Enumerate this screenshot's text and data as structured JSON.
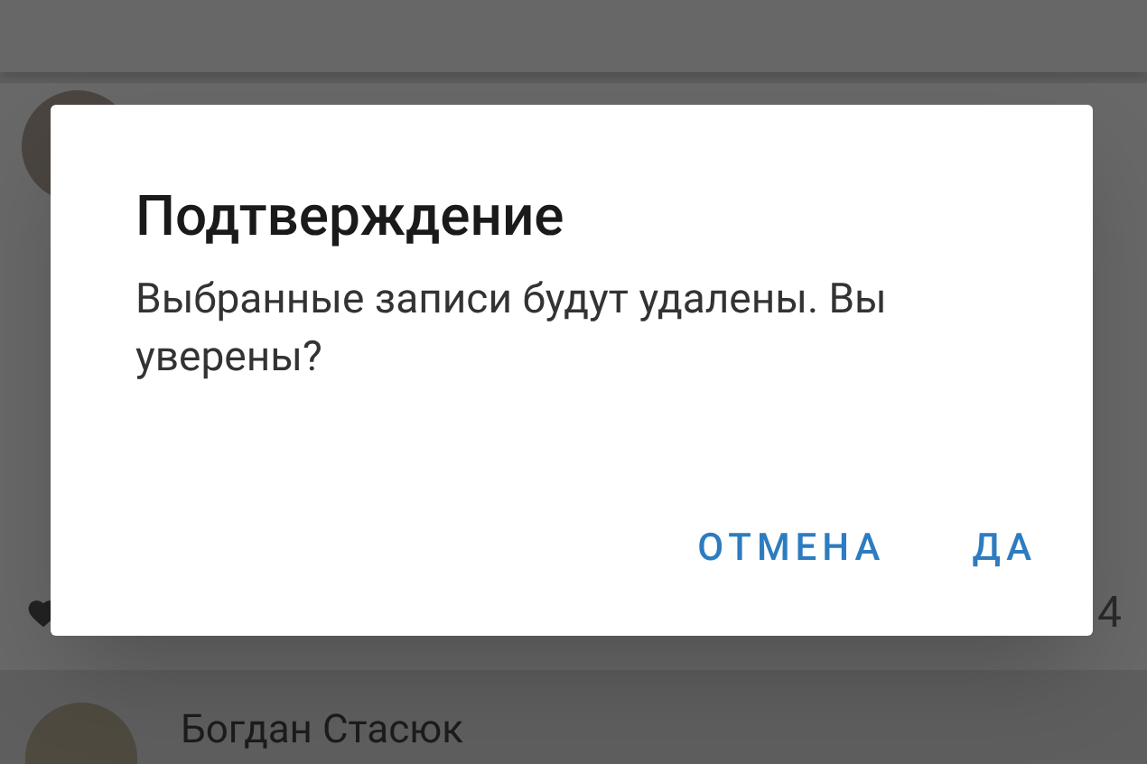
{
  "background": {
    "post": {
      "likes": "4"
    },
    "next_post": {
      "author": "Богдан Стасюк"
    }
  },
  "dialog": {
    "title": "Подтверждение",
    "message": "Выбранные записи будут удалены. Вы уверены?",
    "buttons": [
      {
        "label": "ОТМЕНА"
      },
      {
        "label": "ДА"
      }
    ]
  }
}
